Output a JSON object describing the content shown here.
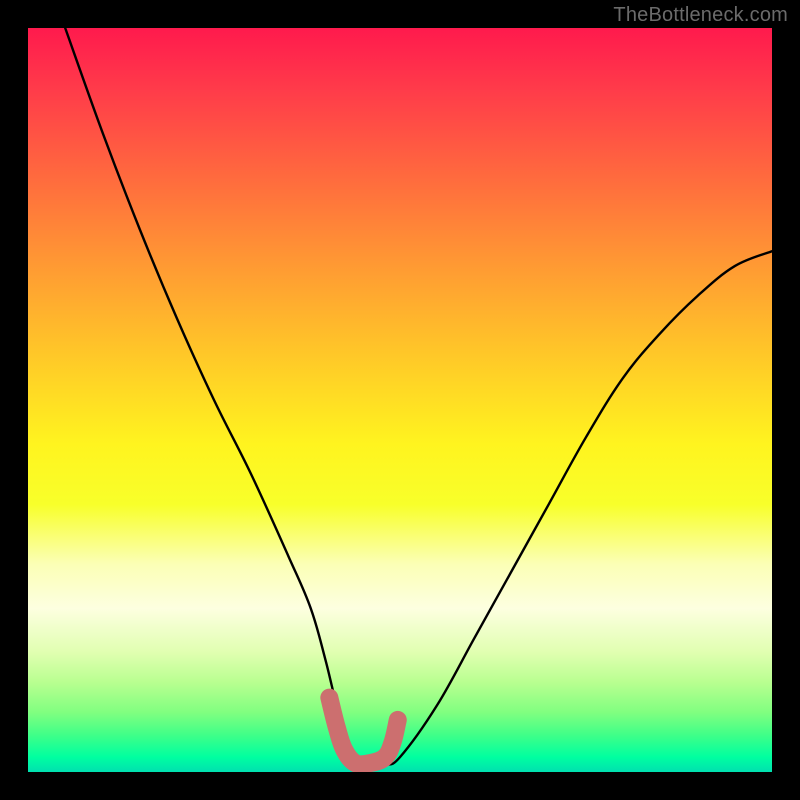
{
  "watermark": "TheBottleneck.com",
  "chart_data": {
    "type": "line",
    "title": "",
    "xlabel": "",
    "ylabel": "",
    "xlim": [
      0,
      100
    ],
    "ylim": [
      0,
      100
    ],
    "background": "rainbow-gradient-bottleneck",
    "series": [
      {
        "name": "bottleneck-curve",
        "x": [
          5,
          10,
          15,
          20,
          25,
          30,
          35,
          38,
          40,
          42,
          44,
          46,
          48,
          50,
          55,
          60,
          65,
          70,
          75,
          80,
          85,
          90,
          95,
          100
        ],
        "y": [
          100,
          86,
          73,
          61,
          50,
          40,
          29,
          22,
          15,
          7,
          2,
          1,
          1,
          2,
          9,
          18,
          27,
          36,
          45,
          53,
          59,
          64,
          68,
          70
        ]
      },
      {
        "name": "valley-marker",
        "x": [
          40.5,
          41.5,
          42.5,
          44,
          46,
          48,
          49,
          49.7
        ],
        "y": [
          10,
          6,
          3,
          1.2,
          1.2,
          2,
          4,
          7
        ]
      }
    ],
    "annotations": [
      {
        "text": "TheBottleneck.com",
        "role": "watermark"
      }
    ],
    "grid": false,
    "legend": null
  },
  "colors": {
    "curve": "#000000",
    "marker": "#cc6f6f",
    "frame": "#000000"
  }
}
